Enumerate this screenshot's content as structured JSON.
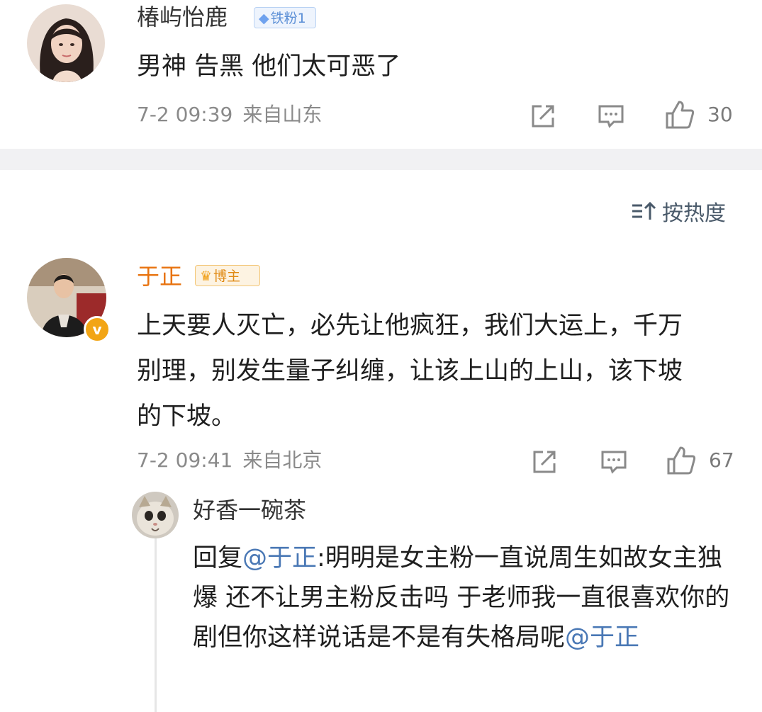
{
  "comment1": {
    "username": "椿屿怡鹿",
    "badge": "铁粉1",
    "text": "男神 告黑 他们太可恶了",
    "date": "7-2 09:39",
    "location": "来自山东",
    "likes": "30"
  },
  "sort": {
    "label": "按热度"
  },
  "comment2": {
    "username": "于正",
    "badge": "博主",
    "text": "上天要人灭亡，必先让他疯狂，我们大运上，千万别理，别发生量子纠缠，让该上山的上山，该下坡的下坡。",
    "date": "7-2 09:41",
    "location": "来自北京",
    "likes": "67"
  },
  "reply": {
    "username": "好香一碗茶",
    "prefix": "回复",
    "mention": "@于正",
    "text": ":明明是女主粉一直说周生如故女主独爆 还不让男主粉反击吗 于老师我一直很喜欢你的剧但你这样说话是不是有失格局呢",
    "trailing_mention": "@于正"
  },
  "icon_names": [
    "share-icon",
    "comment-icon",
    "like-icon",
    "sort-icon",
    "verified-icon"
  ],
  "colors": {
    "blogger_name": "#e8730f",
    "mention": "#4a78b5",
    "fan_badge": "#7da9e8",
    "blogger_badge": "#f3a422"
  }
}
